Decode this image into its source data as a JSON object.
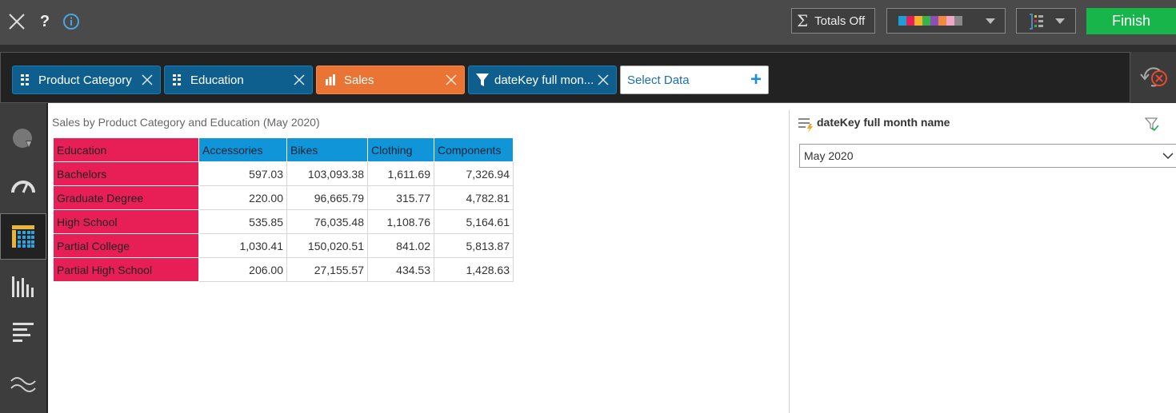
{
  "toolbar": {
    "totals_label": "Totals Off",
    "totals_sigma": "Σ",
    "help_glyph": "?",
    "finish_label": "Finish",
    "palette_colors": [
      "#1a9fd8",
      "#e81f56",
      "#f5b22a",
      "#37b34a",
      "#8c4fb8",
      "#ef8a3e",
      "#f0a6c6",
      "#888888"
    ]
  },
  "shelf": {
    "chips": [
      {
        "label": "Product Category",
        "kind": "dimension"
      },
      {
        "label": "Education",
        "kind": "dimension"
      },
      {
        "label": "Sales",
        "kind": "measure"
      },
      {
        "label": "dateKey full mon...",
        "kind": "filter"
      }
    ],
    "select_data_label": "Select Data",
    "select_data_plus": "+"
  },
  "chart": {
    "title": "Sales by Product Category and Education (May 2020)",
    "row_header": "Education",
    "columns": [
      "Accessories",
      "Bikes",
      "Clothing",
      "Components"
    ],
    "rows": [
      {
        "label": "Bachelors",
        "values": [
          "597.03",
          "103,093.38",
          "1,611.69",
          "7,326.94"
        ]
      },
      {
        "label": "Graduate Degree",
        "values": [
          "220.00",
          "96,665.79",
          "315.77",
          "4,782.81"
        ]
      },
      {
        "label": "High School",
        "values": [
          "535.85",
          "76,035.48",
          "1,108.76",
          "5,164.61"
        ]
      },
      {
        "label": "Partial College",
        "values": [
          "1,030.41",
          "150,020.51",
          "841.02",
          "5,813.87"
        ]
      },
      {
        "label": "Partial High School",
        "values": [
          "206.00",
          "27,155.57",
          "434.53",
          "1,428.63"
        ]
      }
    ]
  },
  "filter_panel": {
    "title": "dateKey full month name",
    "selected_value": "May 2020"
  }
}
